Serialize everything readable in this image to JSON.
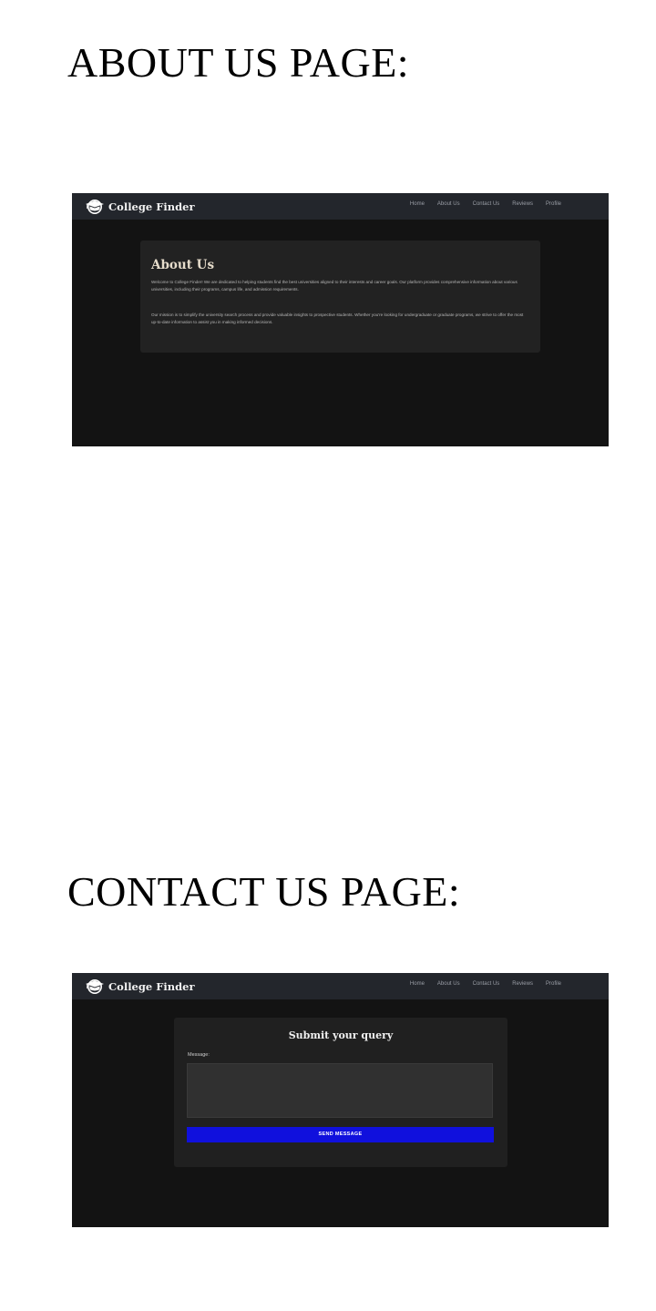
{
  "sections": {
    "about_heading": "ABOUT US PAGE:",
    "contact_heading": "CONTACT US PAGE:"
  },
  "site": {
    "brand": "College Finder",
    "brand_icon": "graduation-cap-icon",
    "nav": [
      "Home",
      "About Us",
      "Contact Us",
      "Reviews",
      "Profile"
    ]
  },
  "about": {
    "title": "About Us",
    "paragraph1": "Welcome to College Finder! We are dedicated to helping students find the best universities aligned to their interests and career goals. Our platform provides comprehensive information about various universities, including their programs, campus life, and admission requirements.",
    "paragraph2": "Our mission is to simplify the university search process and provide valuable insights to prospective students. Whether you're looking for undergraduate or graduate programs, we strive to offer the most up-to-date information to assist you in making informed decisions."
  },
  "contact": {
    "title": "Submit your query",
    "message_label": "Message:",
    "message_value": "",
    "send_label": "SEND MESSAGE"
  },
  "colors": {
    "page_background": "#131313",
    "navbar": "#23262c",
    "card": "#222222",
    "button": "#1010dd"
  }
}
